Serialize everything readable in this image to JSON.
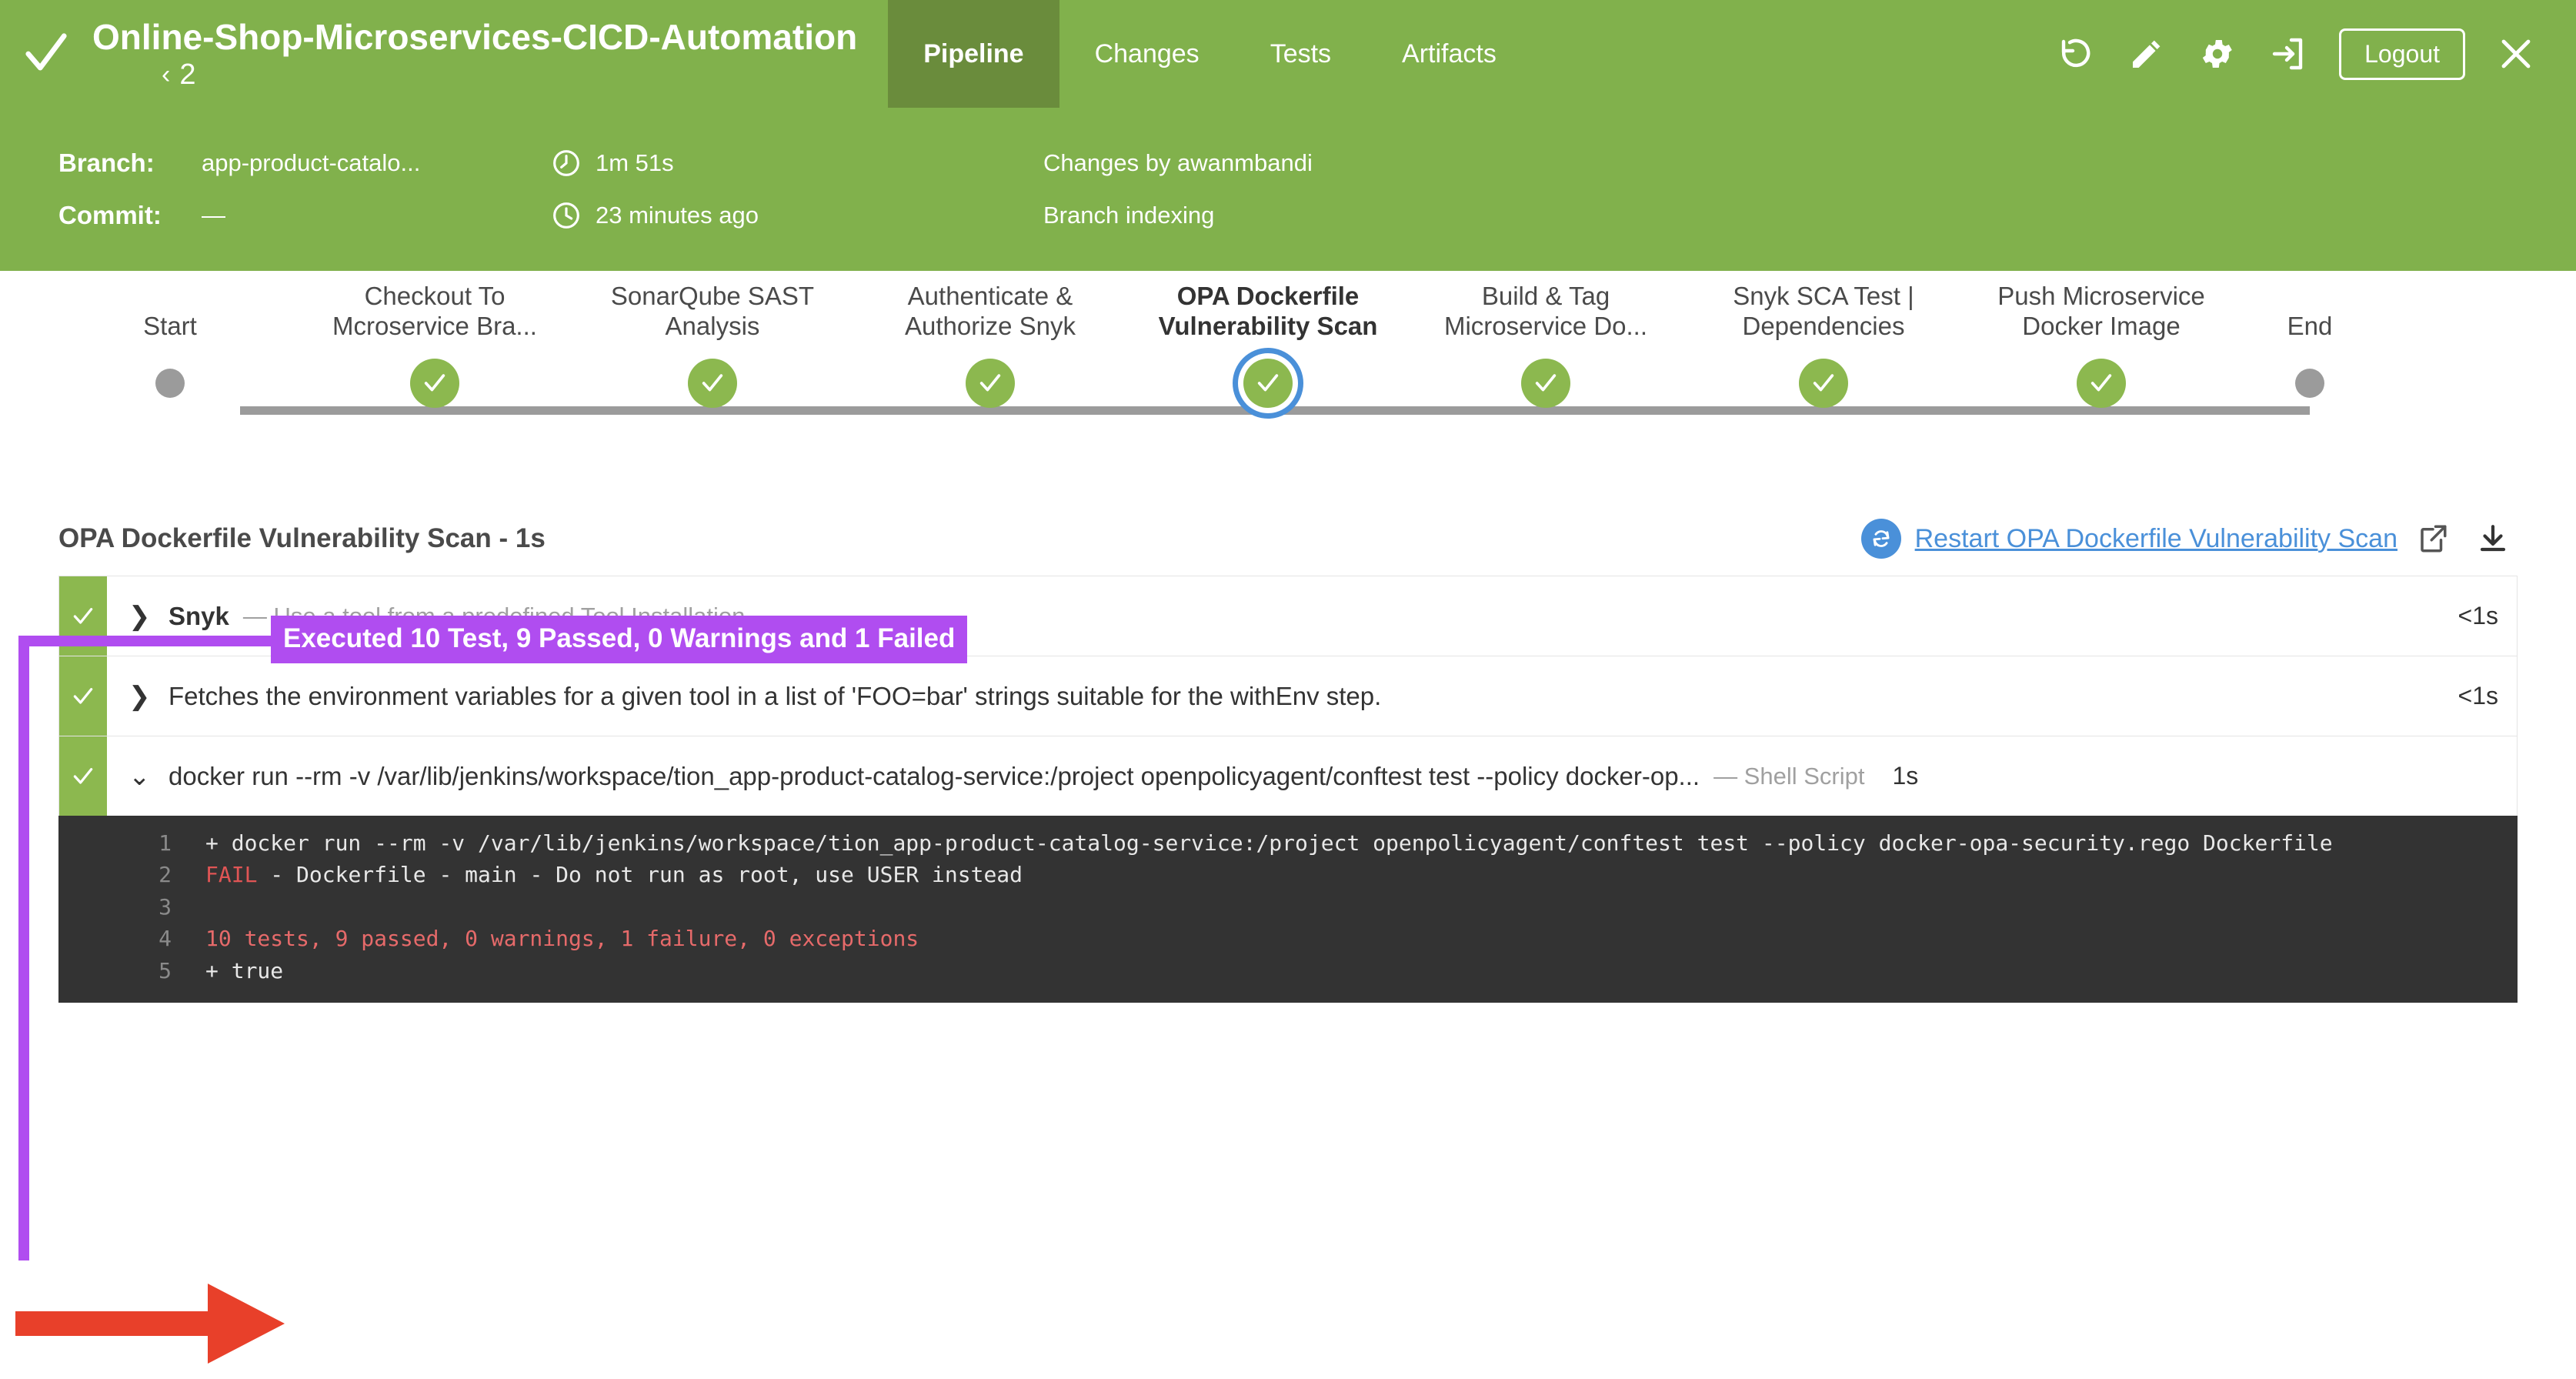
{
  "header": {
    "status_icon": "check-icon",
    "title": "Online-Shop-Microservices-CICD-Automation",
    "run_prev_chevron": "‹",
    "run_number": "2",
    "tabs": [
      {
        "label": "Pipeline",
        "active": true
      },
      {
        "label": "Changes",
        "active": false
      },
      {
        "label": "Tests",
        "active": false
      },
      {
        "label": "Artifacts",
        "active": false
      }
    ],
    "actions": [
      {
        "name": "replay-icon"
      },
      {
        "name": "edit-icon"
      },
      {
        "name": "gear-icon"
      },
      {
        "name": "exit-icon"
      }
    ],
    "logout_label": "Logout",
    "close_icon": "close-icon",
    "bg_color": "#81b14c",
    "active_tab_color": "#6a8c3c"
  },
  "meta": {
    "branch_label": "Branch:",
    "branch_value": "app-product-catalo...",
    "commit_label": "Commit:",
    "commit_value": "—",
    "duration": "1m 51s",
    "duration_icon": "duration-icon",
    "time_ago": "23 minutes ago",
    "time_icon": "clock-icon",
    "changes_by": "Changes by awanmbandi",
    "cause": "Branch indexing"
  },
  "pipeline": {
    "start_label": "Start",
    "end_label": "End",
    "stages": [
      {
        "label": "Checkout To\nMcroservice Bra...",
        "status": "success",
        "selected": false
      },
      {
        "label": "SonarQube SAST\nAnalysis",
        "status": "success",
        "selected": false
      },
      {
        "label": "Authenticate &\nAuthorize Snyk",
        "status": "success",
        "selected": false
      },
      {
        "label": "OPA Dockerfile\nVulnerability Scan",
        "status": "success",
        "selected": true
      },
      {
        "label": "Build & Tag\nMicroservice Do...",
        "status": "success",
        "selected": false
      },
      {
        "label": "Snyk SCA Test |\nDependencies",
        "status": "success",
        "selected": false
      },
      {
        "label": "Push Microservice\nDocker Image",
        "status": "success",
        "selected": false
      }
    ],
    "success_color": "#8cb84f",
    "terminal_color": "#9b9b9b",
    "selected_ring_color": "#4a90d9"
  },
  "annotations": {
    "purple_badge_text": "Executed 10 Test, 9 Passed, 0 Warnings and 1 Failed",
    "purple_color": "#b04df0",
    "arrow_color": "#e8402a"
  },
  "stage_detail": {
    "title": "OPA Dockerfile Vulnerability Scan - 1s",
    "restart_label": "Restart OPA Dockerfile Vulnerability Scan",
    "restart_icon": "restart-icon",
    "open_icon": "external-link-icon",
    "download_icon": "download-icon",
    "link_color": "#4a90d9"
  },
  "steps": [
    {
      "status": "success",
      "expanded": false,
      "chevron": "❯",
      "title": "Snyk",
      "title_bold": true,
      "desc": "— Use a tool from a predefined Tool Installation",
      "kind": "",
      "duration": "<1s"
    },
    {
      "status": "success",
      "expanded": false,
      "chevron": "❯",
      "title": "Fetches the environment variables for a given tool in a list of 'FOO=bar' strings suitable for the withEnv step.",
      "title_bold": false,
      "desc": "",
      "kind": "",
      "duration": "<1s"
    },
    {
      "status": "success",
      "expanded": true,
      "chevron": "⌄",
      "title": "docker run --rm -v /var/lib/jenkins/workspace/tion_app-product-catalog-service:/project openpolicyagent/conftest test --policy docker-op...",
      "title_bold": false,
      "desc": "",
      "kind": "— Shell Script",
      "duration": "1s"
    }
  ],
  "console": {
    "background": "#333333",
    "lines": [
      {
        "num": "1",
        "text": "+ docker run --rm -v /var/lib/jenkins/workspace/tion_app-product-catalog-service:/project openpolicyagent/conftest test --policy docker-opa-security.rego Dockerfile",
        "color": "normal"
      },
      {
        "num": "2",
        "text": "FAIL - Dockerfile - main - Do not run as root, use USER instead",
        "color": "fail-prefix"
      },
      {
        "num": "3",
        "text": "",
        "color": "normal"
      },
      {
        "num": "4",
        "text": "10 tests, 9 passed, 0 warnings, 1 failure, 0 exceptions",
        "color": "red"
      },
      {
        "num": "5",
        "text": "+ true",
        "color": "normal"
      }
    ]
  }
}
